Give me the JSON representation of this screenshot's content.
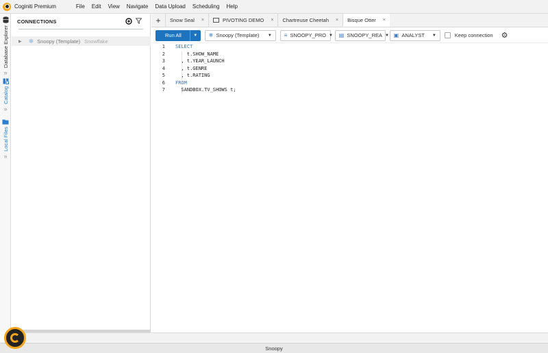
{
  "app": {
    "title": "Coginiti Premium"
  },
  "menu": [
    "File",
    "Edit",
    "View",
    "Navigate",
    "Data Upload",
    "Scheduling",
    "Help"
  ],
  "rail": {
    "database_explorer": "Database Explorer",
    "catalog": "Catalog",
    "local_files": "Local Files"
  },
  "connections": {
    "header": "CONNECTIONS",
    "items": [
      {
        "name": "Snoopy (Template)",
        "type": "Snowflake"
      }
    ]
  },
  "tabs": [
    {
      "label": "Snow Seal",
      "active": false
    },
    {
      "label": "PIVOTING DEMO",
      "active": false,
      "icon": "chart-icon"
    },
    {
      "label": "Chartreuse Cheetah",
      "active": false
    },
    {
      "label": "Bisque Otter",
      "active": true
    }
  ],
  "toolbar": {
    "run_label": "Run All",
    "connection": "Snoopy (Template)",
    "database": "SNOOPY_PRO",
    "schema": "SNOOPY_REA",
    "role": "ANALYST",
    "keep_connection": "Keep connection"
  },
  "code": [
    {
      "n": "1",
      "text": "SELECT",
      "kw": true
    },
    {
      "n": "2",
      "text": "    t.SHOW_NAME",
      "kw": false
    },
    {
      "n": "3",
      "text": "  , t.YEAR_LAUNCH",
      "kw": false
    },
    {
      "n": "4",
      "text": "  , t.GENRE",
      "kw": false
    },
    {
      "n": "5",
      "text": "  , t.RATING",
      "kw": false
    },
    {
      "n": "6",
      "text": "FROM",
      "kw": true
    },
    {
      "n": "7",
      "text": "  SANDBOX.TV_SHOWS t;",
      "kw": false
    }
  ],
  "status": {
    "connection": "Snoopy"
  },
  "colors": {
    "accent": "#1e73be",
    "brand": "#f4a51c",
    "keyword": "#2878c3"
  }
}
